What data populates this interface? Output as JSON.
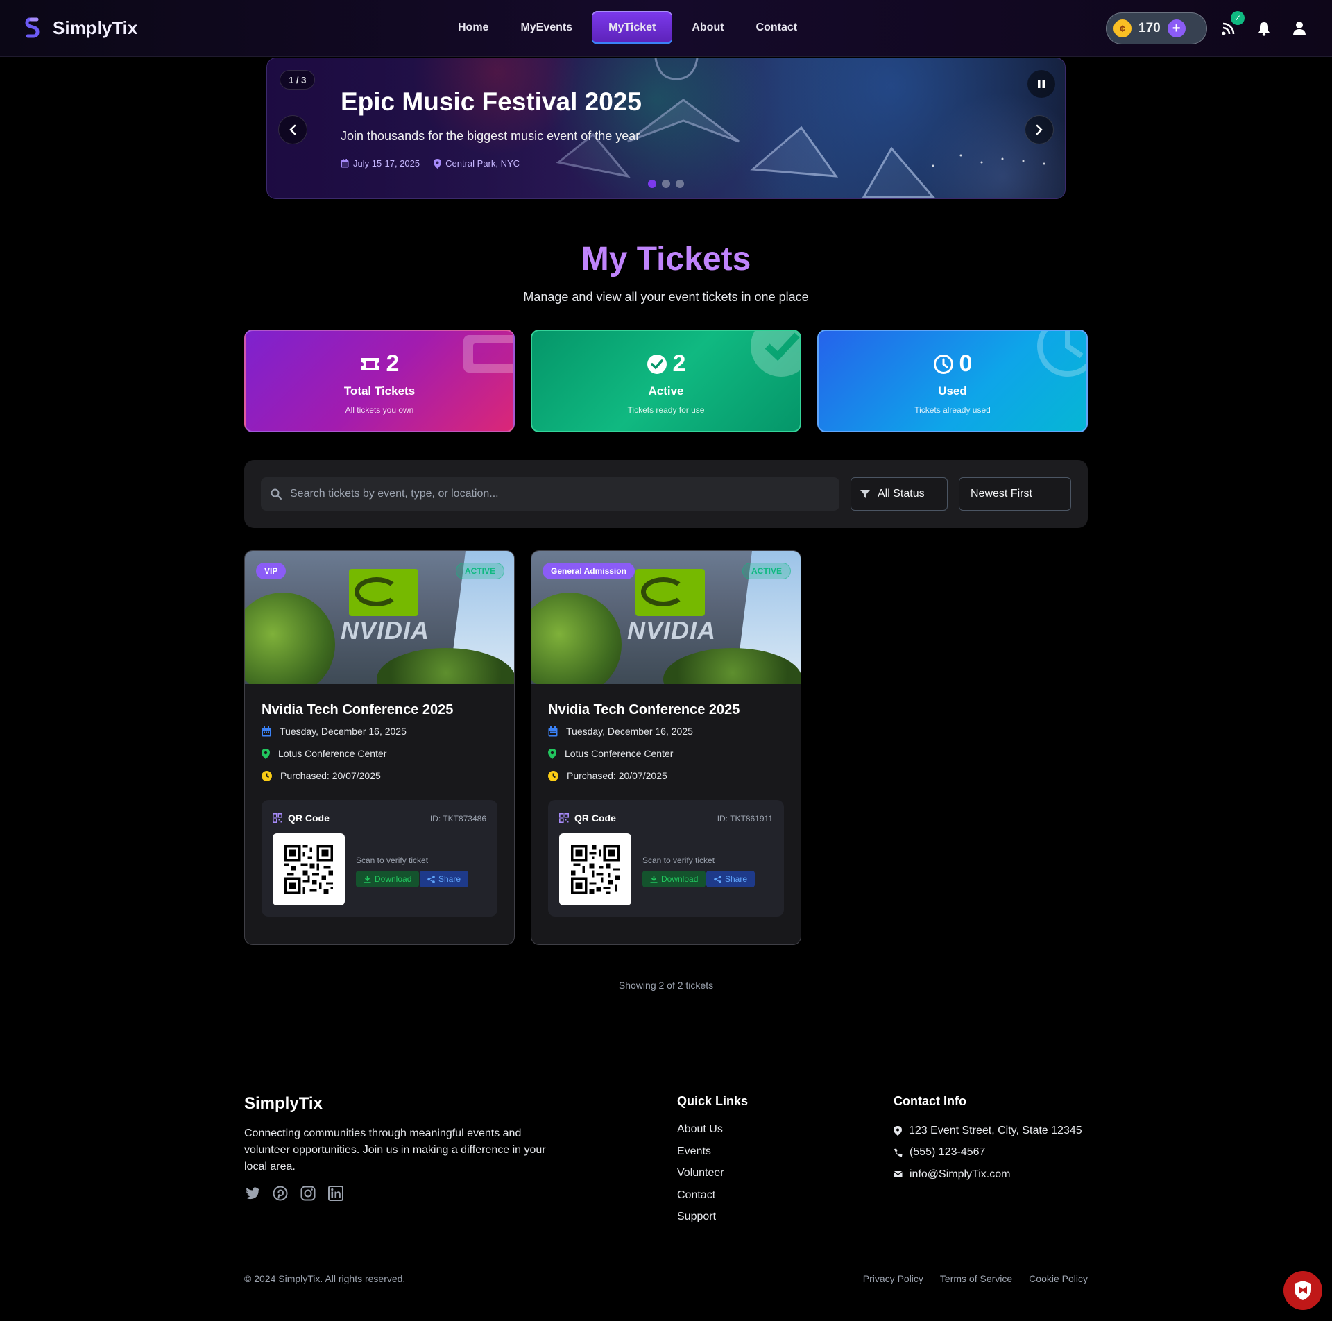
{
  "header": {
    "brand": "SimplyTix",
    "nav": [
      {
        "label": "Home"
      },
      {
        "label": "MyEvents"
      },
      {
        "label": "MyTicket"
      },
      {
        "label": "About"
      },
      {
        "label": "Contact"
      }
    ],
    "active_nav": "MyTicket",
    "coins": "170",
    "coin_symbol": "¢",
    "icons": [
      "logo-icon",
      "coin-icon",
      "add-coins-icon",
      "rss-icon",
      "check-badge-icon",
      "bell-icon",
      "user-icon"
    ]
  },
  "hero": {
    "counter": "1 / 3",
    "title": "Epic Music Festival 2025",
    "subtitle": "Join thousands for the biggest music event of the year",
    "date": "July 15-17, 2025",
    "location": "Central Park, NYC",
    "slides": 3,
    "active_slide": 1
  },
  "page": {
    "title": "My Tickets",
    "subtitle": "Manage and view all your event tickets in one place"
  },
  "stats": [
    {
      "value": "2",
      "label": "Total Tickets",
      "desc": "All tickets you own",
      "icon": "ticket-icon"
    },
    {
      "value": "2",
      "label": "Active",
      "desc": "Tickets ready for use",
      "icon": "check-circle-icon"
    },
    {
      "value": "0",
      "label": "Used",
      "desc": "Tickets already used",
      "icon": "clock-icon"
    }
  ],
  "filters": {
    "search_placeholder": "Search tickets by event, type, or location...",
    "status": "All Status",
    "sort": "Newest First"
  },
  "tickets": [
    {
      "type": "VIP",
      "status": "ACTIVE",
      "brand_text": "NVIDIA",
      "title": "Nvidia Tech Conference 2025",
      "date": "Tuesday, December 16, 2025",
      "venue": "Lotus Conference Center",
      "purchased": "Purchased: 20/07/2025",
      "qr_label": "QR Code",
      "id": "ID: TKT873486",
      "scan": "Scan to verify ticket",
      "download": "Download",
      "share": "Share"
    },
    {
      "type": "General Admission",
      "status": "ACTIVE",
      "brand_text": "NVIDIA",
      "title": "Nvidia Tech Conference 2025",
      "date": "Tuesday, December 16, 2025",
      "venue": "Lotus Conference Center",
      "purchased": "Purchased: 20/07/2025",
      "qr_label": "QR Code",
      "id": "ID: TKT861911",
      "scan": "Scan to verify ticket",
      "download": "Download",
      "share": "Share"
    }
  ],
  "showing": "Showing 2 of 2 tickets",
  "footer": {
    "brand": "SimplyTix",
    "description": "Connecting communities through meaningful events and volunteer opportunities. Join us in making a difference in your local area.",
    "quick_links_title": "Quick Links",
    "quick_links": [
      "About Us",
      "Events",
      "Volunteer",
      "Contact",
      "Support"
    ],
    "contact_title": "Contact Info",
    "address": "123 Event Street, City, State 12345",
    "phone": "(555) 123-4567",
    "email": "info@SimplyTix.com",
    "copyright": "© 2024 SimplyTix. All rights reserved.",
    "legal": [
      "Privacy Policy",
      "Terms of Service",
      "Cookie Policy"
    ],
    "social": [
      "twitter-icon",
      "pinterest-icon",
      "instagram-icon",
      "linkedin-icon"
    ]
  },
  "colors": {
    "accent": "#7c3aed",
    "active_green": "#10b981",
    "title_purple": "#c084fc"
  }
}
